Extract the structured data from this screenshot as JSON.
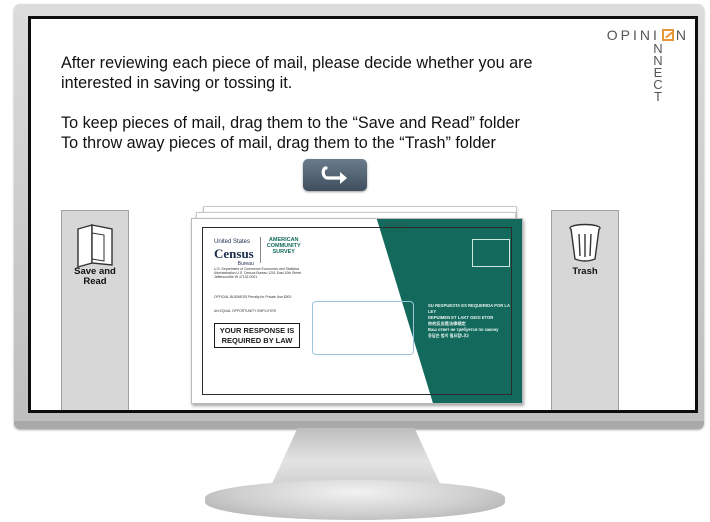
{
  "logo": {
    "word": "OPINI",
    "vertical_letters": [
      "N",
      "N",
      "E",
      "C",
      "T"
    ],
    "word_end": "N"
  },
  "instructions": {
    "line1": "After reviewing each piece of mail, please decide whether you are",
    "line2": "interested in saving or tossing it.",
    "line3": "To keep pieces of mail, drag them to the “Save and Read” folder",
    "line4": "To throw away pieces of mail, drag them to the “Trash” folder"
  },
  "undo_button": {
    "icon": "undo-arrow-icon"
  },
  "save_folder": {
    "label_line1": "Save and",
    "label_line2": "Read",
    "icon": "folder-icon"
  },
  "trash_folder": {
    "label": "Trash",
    "icon": "trash-icon"
  },
  "envelope": {
    "census_top": "United States",
    "census_word": "Census",
    "census_sub": "Bureau",
    "acs_line1": "AMERICAN",
    "acs_line2": "COMMUNITY",
    "acs_line3": "SURVEY",
    "return_address": "U.S. Department of Commerce Economics and Statistics Administration U.S. Census Bureau 1201 East 10th Street Jeffersonville IN 47132-0001",
    "official": "OFFICIAL BUSINESS Penalty for Private Use $300",
    "equal_opportunity": "AN EQUAL OPPORTUNITY EMPLOYER",
    "required_line1": "YOUR RESPONSE IS",
    "required_line2": "REQUIRED BY LAW",
    "barcode": "|| | || |",
    "multilingual_1": "SU RESPUESTA ES REQUERIDA POR LA LEY",
    "multilingual_2": "DEPUIMEN ET LAKT GEOI ETOR",
    "multilingual_3": "你的反应是法律规定",
    "multilingual_4": "Ваш ответ не требуется по закону",
    "multilingual_5": "응답은 법이 필요합니다"
  },
  "colors": {
    "accent_orange": "#e8963a",
    "envelope_green": "#136a5c",
    "button": "#4f6072"
  }
}
